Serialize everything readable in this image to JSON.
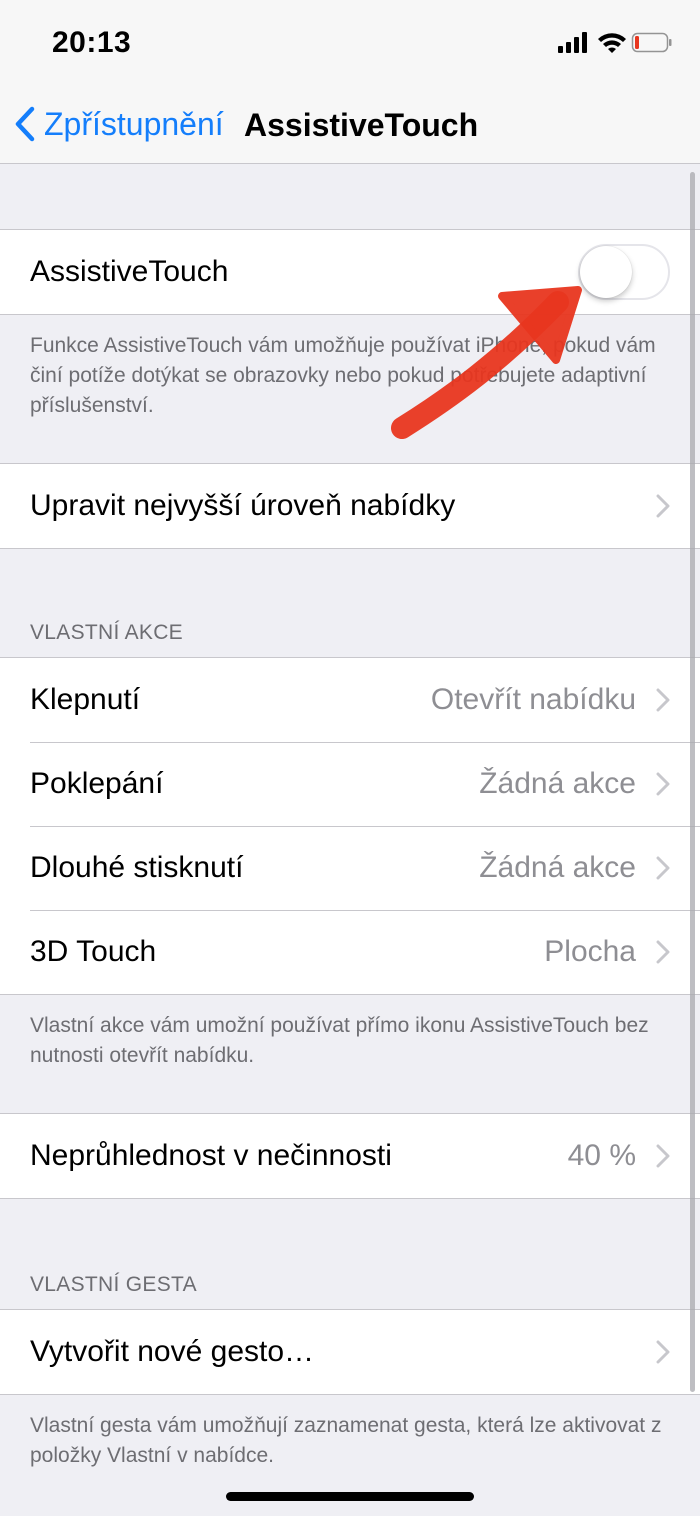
{
  "status": {
    "time": "20:13"
  },
  "nav": {
    "back_label": "Zpřístupnění",
    "title": "AssistiveTouch"
  },
  "toggle_section": {
    "label": "AssistiveTouch",
    "enabled": false,
    "footer": "Funkce AssistiveTouch vám umožňuje používat iPhone, pokud vám činí potíže dotýkat se obrazovky nebo pokud potřebujete adaptivní příslušenství."
  },
  "menu_row": {
    "label": "Upravit nejvyšší úroveň nabídky"
  },
  "custom_actions": {
    "header": "VLASTNÍ AKCE",
    "rows": [
      {
        "label": "Klepnutí",
        "value": "Otevřít nabídku"
      },
      {
        "label": "Poklepání",
        "value": "Žádná akce"
      },
      {
        "label": "Dlouhé stisknutí",
        "value": "Žádná akce"
      },
      {
        "label": "3D Touch",
        "value": "Plocha"
      }
    ],
    "footer": "Vlastní akce vám umožní používat přímo ikonu AssistiveTouch bez nutnosti otevřít nabídku."
  },
  "opacity_row": {
    "label": "Neprůhlednost v nečinnosti",
    "value": "40 %"
  },
  "custom_gestures": {
    "header": "VLASTNÍ GESTA",
    "row_label": "Vytvořit nové gesto…",
    "footer": "Vlastní gesta vám umožňují zaznamenat gesta, která lze aktivovat z položky Vlastní v nabídce."
  },
  "colors": {
    "accent": "#147efb",
    "annotation": "#e8361f",
    "background": "#efeff4"
  }
}
